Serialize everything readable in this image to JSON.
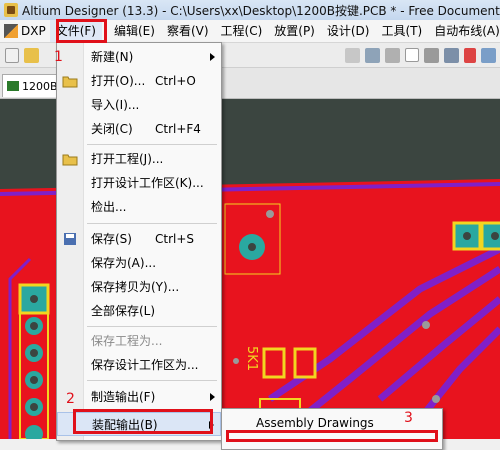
{
  "window": {
    "title": "Altium Designer (13.3) - C:\\Users\\xx\\Desktop\\1200B按键.PCB * - Free Documents. Not"
  },
  "menubar": {
    "dxp": "DXP",
    "items": [
      "文件(F)",
      "编辑(E)",
      "察看(V)",
      "工程(C)",
      "放置(P)",
      "设计(D)",
      "工具(T)",
      "自动布线(A)"
    ]
  },
  "doc_tab": {
    "label": "1200B"
  },
  "file_menu": {
    "items": [
      {
        "label": "新建(N)",
        "shortcut": "",
        "submenu": true,
        "disabled": false,
        "icon": ""
      },
      {
        "label": "打开(O)...",
        "shortcut": "Ctrl+O",
        "submenu": false,
        "disabled": false,
        "icon": "folder-open-icon"
      },
      {
        "label": "导入(I)...",
        "shortcut": "",
        "submenu": false,
        "disabled": false,
        "icon": ""
      },
      {
        "label": "关闭(C)",
        "shortcut": "Ctrl+F4",
        "submenu": false,
        "disabled": false,
        "icon": ""
      },
      {
        "label": "打开工程(J)...",
        "shortcut": "",
        "submenu": false,
        "disabled": false,
        "icon": "folder-open-icon"
      },
      {
        "label": "打开设计工作区(K)...",
        "shortcut": "",
        "submenu": false,
        "disabled": false,
        "icon": ""
      },
      {
        "label": "检出...",
        "shortcut": "",
        "submenu": false,
        "disabled": false,
        "icon": ""
      },
      {
        "label": "保存(S)",
        "shortcut": "Ctrl+S",
        "submenu": false,
        "disabled": false,
        "icon": "floppy-disk-icon"
      },
      {
        "label": "保存为(A)...",
        "shortcut": "",
        "submenu": false,
        "disabled": false,
        "icon": ""
      },
      {
        "label": "保存拷贝为(Y)...",
        "shortcut": "",
        "submenu": false,
        "disabled": false,
        "icon": ""
      },
      {
        "label": "全部保存(L)",
        "shortcut": "",
        "submenu": false,
        "disabled": false,
        "icon": ""
      },
      {
        "label": "保存工程为...",
        "shortcut": "",
        "submenu": false,
        "disabled": true,
        "icon": ""
      },
      {
        "label": "保存设计工作区为...",
        "shortcut": "",
        "submenu": false,
        "disabled": false,
        "icon": ""
      },
      {
        "label": "制造输出(F)",
        "shortcut": "",
        "submenu": true,
        "disabled": false,
        "icon": ""
      },
      {
        "label": "装配输出(B)",
        "shortcut": "",
        "submenu": true,
        "disabled": false,
        "icon": ""
      }
    ]
  },
  "submenu": {
    "items": [
      "Assembly Drawings"
    ]
  },
  "annotations": {
    "step1": "1",
    "step2": "2",
    "step3": "3"
  },
  "pcb": {
    "silkscreen_label": "5K1"
  },
  "colors": {
    "board": "#e8131e",
    "keepout": "#8020c8",
    "pad": "#2aa8a0",
    "silk": "#f2d620",
    "callout": "#e0101a"
  }
}
